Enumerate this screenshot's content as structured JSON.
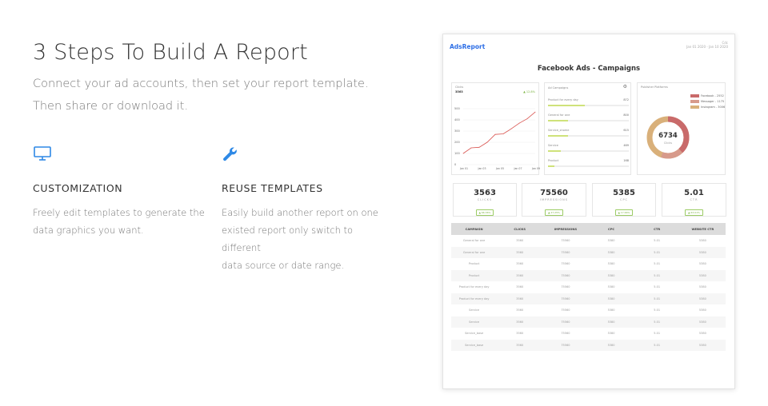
{
  "hero": {
    "title": "3 Steps To Build A Report",
    "subtitle_line1": "Connect your ad accounts, then set your report template.",
    "subtitle_line2": "Then share or download it."
  },
  "features": [
    {
      "icon": "monitor-icon",
      "title": "CUSTOMIZATION",
      "line1": "Freely edit templates to generate the",
      "line2": "data graphics you want."
    },
    {
      "icon": "wrench-icon",
      "title": "REUSE TEMPLATES",
      "line1": "Easily build another report on one",
      "line2": "existed report only switch to different",
      "line3": "data source or date range."
    }
  ],
  "colors": {
    "accent_blue": "#2e89e6",
    "line_red": "#d9534f",
    "bar_green": "#cfe27a"
  },
  "report": {
    "logo": "AdsReport",
    "top_right_line1": "Cdc",
    "top_right_line2": "Jan 01 2020 - Jan 10 2020",
    "title": "Facebook Ads - Campaigns",
    "line_card": {
      "title": "Clicks",
      "value": "3563",
      "tag": "▲ 12.8%",
      "y_ticks": [
        "500",
        "400",
        "300",
        "200",
        "100",
        "0"
      ],
      "x_ticks": [
        "Jan 01",
        "Jan 03",
        "Jan 05",
        "Jan 07",
        "Jan 09"
      ]
    },
    "bar_card": {
      "title": "Ad Campaigns",
      "rows": [
        {
          "label": "Product for every day",
          "value": "872",
          "pct": 0.46
        },
        {
          "label": "General for one",
          "value": "800",
          "pct": 0.25
        },
        {
          "label": "Service_shome",
          "value": "615",
          "pct": 0.25
        },
        {
          "label": "Service",
          "value": "469",
          "pct": 0.16
        },
        {
          "label": "Product",
          "value": "168",
          "pct": 0.08
        }
      ]
    },
    "donut_card": {
      "title": "Publisher Platforms",
      "total": "6734",
      "total_label": "Clicks",
      "legend": [
        {
          "label": "Facebook - 2552",
          "color": "#c96a6a"
        },
        {
          "label": "Messager - 1175",
          "color": "#d79a8b"
        },
        {
          "label": "Instagram - 3006",
          "color": "#d9b07a"
        }
      ]
    },
    "kpis": [
      {
        "value": "3563",
        "label": "CLICKS",
        "badge": "▲ 66.36%"
      },
      {
        "value": "75560",
        "label": "IMPRESSIONS",
        "badge": "▲ 27.25%"
      },
      {
        "value": "5385",
        "label": "CPC",
        "badge": "▲ 17.66%"
      },
      {
        "value": "5.01",
        "label": "CTR",
        "badge": "▲ 63.01%"
      }
    ],
    "table": {
      "headers": [
        "CAMPAIGN",
        "CLICKS",
        "IMPRESSIONS",
        "CPC",
        "CTR",
        "WEBSITE CTR"
      ],
      "rows": [
        [
          "General for one",
          "3560",
          "75560",
          "5380",
          "5.01",
          "5380"
        ],
        [
          "General for one",
          "3560",
          "75560",
          "5380",
          "5.01",
          "5380"
        ],
        [
          "Product",
          "3560",
          "75560",
          "5380",
          "5.01",
          "5380"
        ],
        [
          "Product",
          "3560",
          "75560",
          "5380",
          "5.01",
          "5380"
        ],
        [
          "Product for every day",
          "3560",
          "75560",
          "5380",
          "5.01",
          "5380"
        ],
        [
          "Product for every day",
          "3560",
          "75560",
          "5380",
          "5.01",
          "5380"
        ],
        [
          "Service",
          "3560",
          "75560",
          "5380",
          "5.01",
          "5380"
        ],
        [
          "Service",
          "3560",
          "75560",
          "5380",
          "5.01",
          "5380"
        ],
        [
          "Service_base",
          "3560",
          "75560",
          "5380",
          "5.01",
          "5380"
        ],
        [
          "Service_base",
          "3560",
          "75560",
          "5380",
          "5.01",
          "5380"
        ]
      ]
    }
  },
  "chart_data": {
    "type": "line",
    "x": [
      "Jan 01",
      "Jan 02",
      "Jan 03",
      "Jan 04",
      "Jan 05",
      "Jan 06",
      "Jan 07",
      "Jan 08",
      "Jan 09",
      "Jan 10"
    ],
    "series": [
      {
        "values": [
          100,
          150,
          155,
          200,
          270,
          275,
          320,
          370,
          410,
          470
        ]
      }
    ],
    "ylim": [
      0,
      500
    ]
  }
}
